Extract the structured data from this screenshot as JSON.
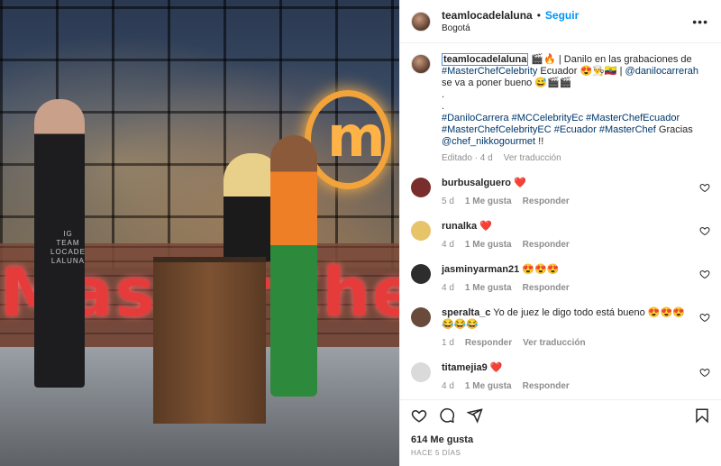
{
  "post": {
    "username": "teamlocadelaluna",
    "follow_label": "Seguir",
    "location": "Bogotá",
    "watermark": "IG\nTEAM\nLOCADE\nLALUNA",
    "sign_text": "MasterChef"
  },
  "caption": {
    "username": "teamlocadelaluna",
    "text_1": "🎬🔥 | Danilo en las grabaciones de ",
    "link_1": "#MasterChefCelebrity",
    "text_2": " Ecuador 😍👨‍🍳🇪🇨 | ",
    "link_2": "@danilocarrerah",
    "text_3": " se va a poner bueno 😅🎬🎬",
    "dot_1": ".",
    "dot_2": ".",
    "tags": "#DaniloCarrera #MCCelebrityEc #MasterChefEcuador #MasterChefCelebrityEC #Ecuador #MasterChef",
    "thanks": " Gracias ",
    "link_3": "@chef_nikkogourmet",
    "end": " !!",
    "edited": "Editado · 4 d",
    "translate": "Ver traducción"
  },
  "comments": [
    {
      "username": "burbusalguero",
      "text": " ❤️",
      "time": "5 d",
      "likes": "1 Me gusta",
      "reply": "Responder",
      "color": "#7a2d2d"
    },
    {
      "username": "runalka",
      "text": " ❤️",
      "time": "4 d",
      "likes": "1 Me gusta",
      "reply": "Responder",
      "color": "#e7c36a"
    },
    {
      "username": "jasminyarman21",
      "text": " 😍😍😍",
      "time": "4 d",
      "likes": "1 Me gusta",
      "reply": "Responder",
      "color": "#2d2d2d"
    },
    {
      "username": "speralta_c",
      "text": " Yo de juez le digo todo está bueno 😍😍😍😂😂😂",
      "time": "1 d",
      "likes": "",
      "reply": "Responder",
      "translate": "Ver traducción",
      "color": "#6a4a3a"
    },
    {
      "username": "titamejia9",
      "text": " ❤️",
      "time": "4 d",
      "likes": "1 Me gusta",
      "reply": "Responder",
      "color": "#dadada"
    }
  ],
  "footer": {
    "likes": "614 Me gusta",
    "ago": "HACE 5 DÍAS"
  },
  "icons": {
    "more": "more-options-icon",
    "like": "heart-icon",
    "comment": "comment-icon",
    "share": "share-icon",
    "save": "bookmark-icon"
  }
}
